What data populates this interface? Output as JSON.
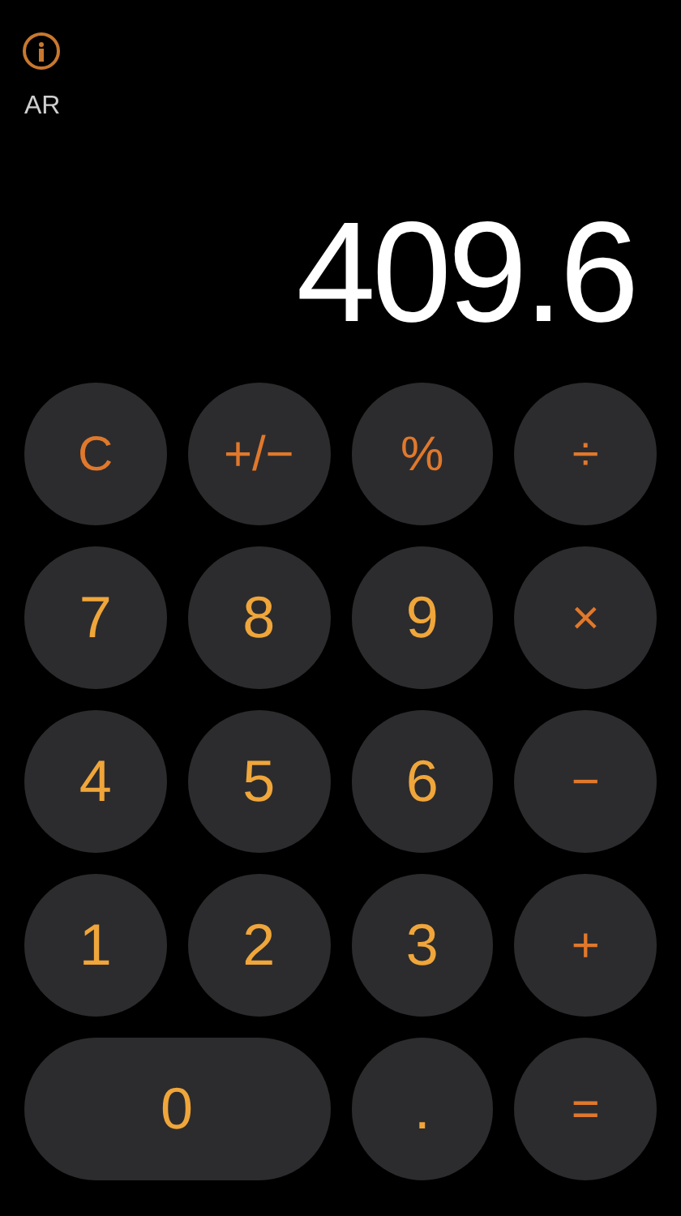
{
  "mode_label": "AR",
  "display": "409.6",
  "keys": [
    {
      "label": "C",
      "kind": "function",
      "wide": false
    },
    {
      "label": "+/−",
      "kind": "function",
      "wide": false
    },
    {
      "label": "%",
      "kind": "function",
      "wide": false
    },
    {
      "label": "÷",
      "kind": "operator",
      "wide": false
    },
    {
      "label": "7",
      "kind": "digit",
      "wide": false
    },
    {
      "label": "8",
      "kind": "digit",
      "wide": false
    },
    {
      "label": "9",
      "kind": "digit",
      "wide": false
    },
    {
      "label": "×",
      "kind": "operator",
      "wide": false
    },
    {
      "label": "4",
      "kind": "digit",
      "wide": false
    },
    {
      "label": "5",
      "kind": "digit",
      "wide": false
    },
    {
      "label": "6",
      "kind": "digit",
      "wide": false
    },
    {
      "label": "−",
      "kind": "operator",
      "wide": false
    },
    {
      "label": "1",
      "kind": "digit",
      "wide": false
    },
    {
      "label": "2",
      "kind": "digit",
      "wide": false
    },
    {
      "label": "3",
      "kind": "digit",
      "wide": false
    },
    {
      "label": "+",
      "kind": "operator",
      "wide": false
    },
    {
      "label": "0",
      "kind": "digit",
      "wide": true
    },
    {
      "label": ".",
      "kind": "digit",
      "wide": false
    },
    {
      "label": "=",
      "kind": "operator",
      "wide": false
    }
  ]
}
